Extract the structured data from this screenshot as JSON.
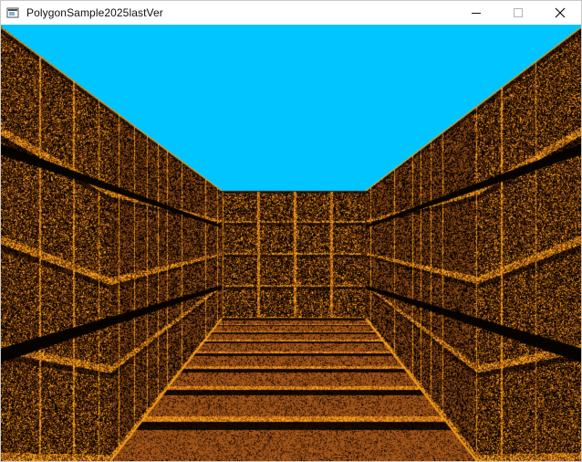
{
  "window": {
    "title": "PolygonSample2025lastVer",
    "icon": "app-window-icon",
    "controls": {
      "minimize": "minimize-icon",
      "maximize": "maximize-icon",
      "close": "close-icon"
    }
  },
  "game": {
    "scene": "first-person-dungeon-corridor",
    "colors": {
      "sky": "#00C5FF",
      "wall_dark": "#4A2308",
      "wall_mid": "#8B4A14",
      "wall_highlight": "#F5A015",
      "floor_plank": "#A8561A",
      "floor_gap": "#1A0B02",
      "mortar": "#070300"
    }
  }
}
